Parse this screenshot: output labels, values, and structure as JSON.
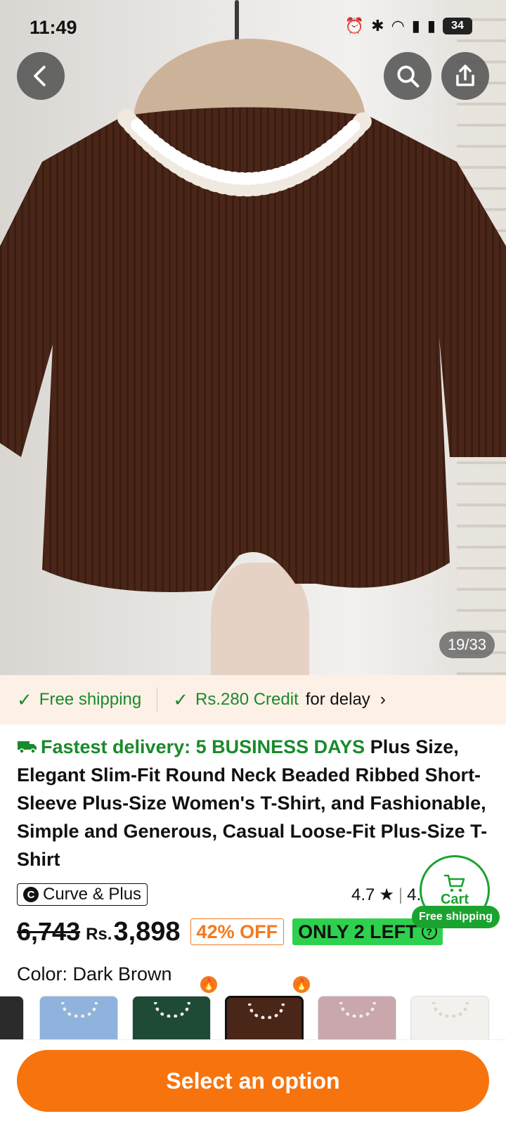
{
  "status": {
    "time": "11:49",
    "battery": "34",
    "icons": [
      "alarm-icon",
      "bluetooth-icon",
      "wifi-icon",
      "signal-icon",
      "signal-icon"
    ]
  },
  "gallery": {
    "counter": "19/33"
  },
  "shipping": {
    "free": "Free shipping",
    "credit": "Rs.280 Credit",
    "credit_suffix": "for delay"
  },
  "product": {
    "fast_delivery": "Fastest delivery: 5 BUSINESS DAYS",
    "title": "Plus Size, Elegant Slim-Fit Round Neck Beaded Ribbed Short-Sleeve Plus-Size Women's T-Shirt, and Fashionable, Simple and Generous, Casual Loose-Fit Plus-Size T-Shirt",
    "brand": "Curve & Plus",
    "brand_initial": "C",
    "rating": "4.7",
    "rating_extra": "4.",
    "old_price": "6,743",
    "currency": "Rs.",
    "price": "3,898",
    "discount": "42% OFF",
    "stock": "ONLY 2 LEFT",
    "color_label": "Color: Dark Brown"
  },
  "cart": {
    "label": "Cart",
    "badge": "Free shipping"
  },
  "swatch_colors": [
    "#2b2b2b",
    "#8fb3dc",
    "#1f4a36",
    "#4a2618",
    "#c9a7ad",
    "#f3f1ee"
  ],
  "cta": {
    "label": "Select an option"
  },
  "colors": {
    "accent": "#f7730d",
    "green": "#1a8a2b",
    "stock_green": "#2ed14d"
  }
}
